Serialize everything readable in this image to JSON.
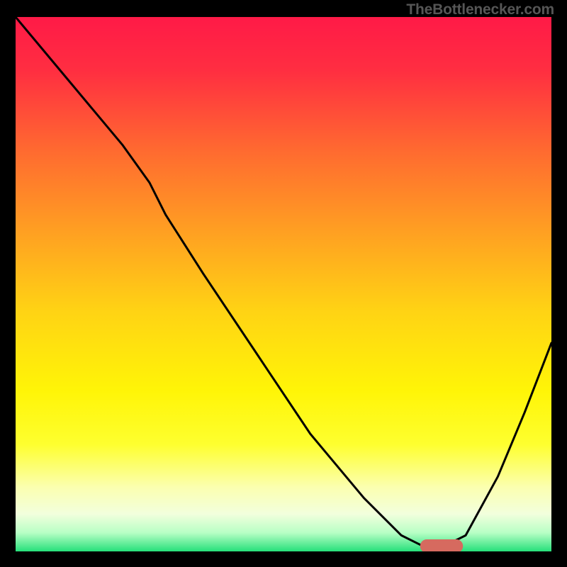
{
  "watermark": "TheBottlenecker.com",
  "chart_data": {
    "type": "line",
    "title": "",
    "xlabel": "",
    "ylabel": "",
    "xlim": [
      0,
      100
    ],
    "ylim": [
      0,
      100
    ],
    "grid": false,
    "legend": false,
    "background_gradient": {
      "stops": [
        {
          "offset": 0.0,
          "color": "#ff1a47"
        },
        {
          "offset": 0.1,
          "color": "#ff2e41"
        },
        {
          "offset": 0.25,
          "color": "#ff6a30"
        },
        {
          "offset": 0.4,
          "color": "#ff9f22"
        },
        {
          "offset": 0.55,
          "color": "#ffd314"
        },
        {
          "offset": 0.7,
          "color": "#fff507"
        },
        {
          "offset": 0.8,
          "color": "#feff2f"
        },
        {
          "offset": 0.88,
          "color": "#fbffb0"
        },
        {
          "offset": 0.93,
          "color": "#f2ffdd"
        },
        {
          "offset": 0.965,
          "color": "#b8ffc5"
        },
        {
          "offset": 1.0,
          "color": "#26e07a"
        }
      ]
    },
    "series": [
      {
        "name": "bottleneck-curve",
        "color": "#000000",
        "x": [
          0,
          5,
          10,
          15,
          20,
          25,
          28,
          35,
          45,
          55,
          65,
          72,
          76,
          80,
          84,
          90,
          95,
          100
        ],
        "y": [
          100,
          94,
          88,
          82,
          76,
          69,
          63,
          52,
          37,
          22,
          10,
          3,
          1,
          1,
          3,
          14,
          26,
          39
        ]
      }
    ],
    "marker": {
      "name": "optimal-range",
      "color": "#d66a5f",
      "x_start": 75.5,
      "x_end": 83.5,
      "y": 1.0,
      "thickness": 2.5
    }
  }
}
